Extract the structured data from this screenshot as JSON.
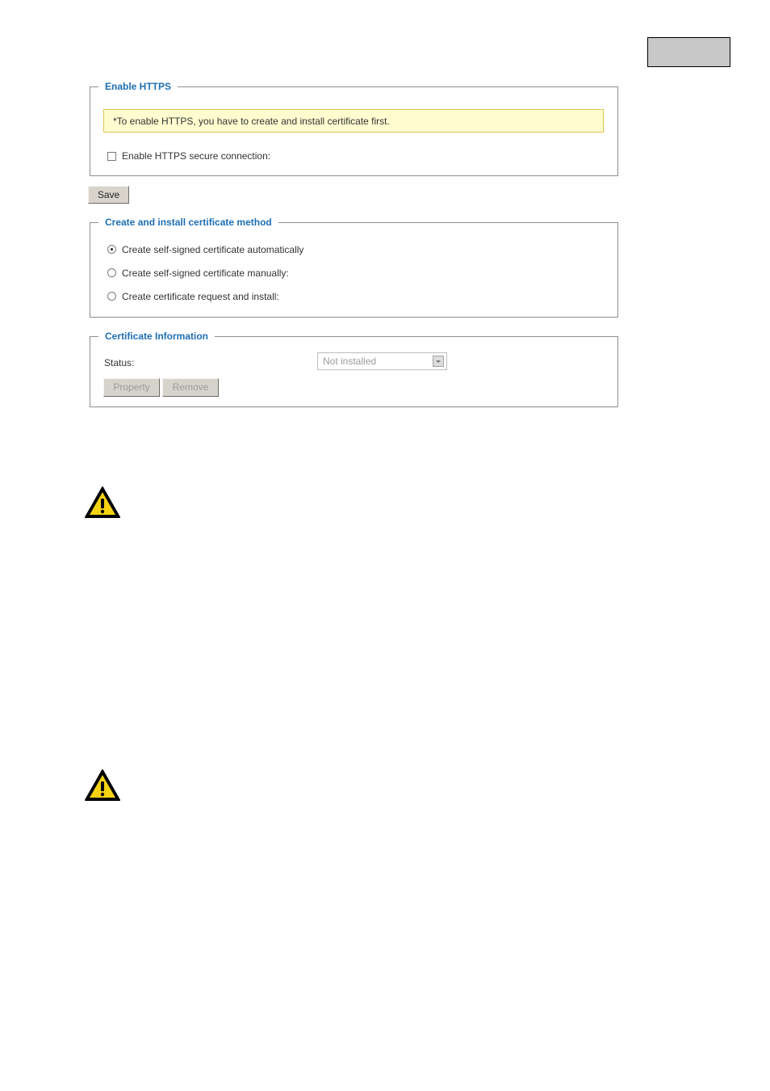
{
  "https_section": {
    "legend": "Enable HTTPS",
    "note": "*To enable HTTPS, you have to create and install certificate first.",
    "checkbox_label": "Enable HTTPS secure connection:",
    "checkbox_checked": false
  },
  "save_label": "Save",
  "method_section": {
    "legend": "Create and install certificate method",
    "options": [
      {
        "label": "Create self-signed certificate automatically",
        "selected": true
      },
      {
        "label": "Create self-signed certificate manually:",
        "selected": false
      },
      {
        "label": "Create certificate request and install:",
        "selected": false
      }
    ]
  },
  "cert_section": {
    "legend": "Certificate Information",
    "status_label": "Status:",
    "status_value": "Not installed",
    "property_label": "Property",
    "remove_label": "Remove"
  },
  "icons": [
    "warning-icon",
    "warning-icon"
  ],
  "colors": {
    "legend": "#1e6fb3",
    "note_background": "#fffdd0",
    "note_border": "#dfc44c",
    "warning_yellow": "#f5d313"
  }
}
